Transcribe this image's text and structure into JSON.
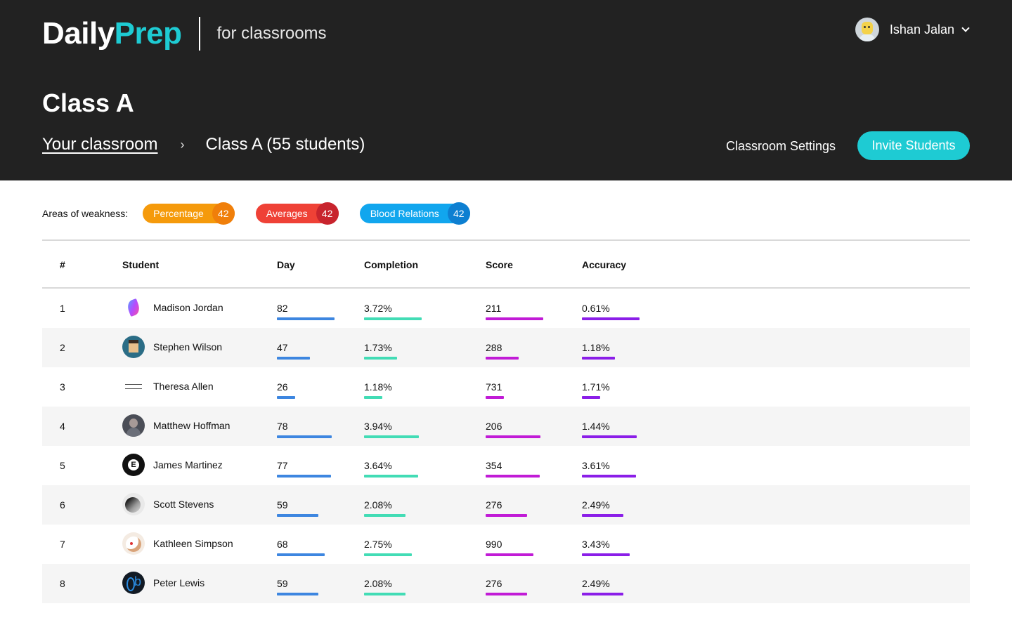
{
  "brand": {
    "part1": "Daily",
    "part2": "Prep",
    "subtitle": "for classrooms"
  },
  "user": {
    "name": "Ishan Jalan",
    "avatar_icon": "user-avatar"
  },
  "page": {
    "title": "Class A"
  },
  "breadcrumb": {
    "link": "Your classroom",
    "separator": "›",
    "current": "Class A (55 students)"
  },
  "actions": {
    "settings": "Classroom Settings",
    "invite": "Invite Students"
  },
  "weakness": {
    "label": "Areas of weakness:",
    "chips": [
      {
        "label": "Percentage",
        "count": "42",
        "color": "#f59a0b"
      },
      {
        "label": "Averages",
        "count": "42",
        "color": "#ef4136"
      },
      {
        "label": "Blood Relations",
        "count": "42",
        "color": "#11a6ee"
      }
    ]
  },
  "table": {
    "headers": {
      "num": "#",
      "student": "Student",
      "day": "Day",
      "completion": "Completion",
      "score": "Score",
      "accuracy": "Accuracy"
    },
    "bar_colors": {
      "day": "#3d86e0",
      "completion": "#42dcb5",
      "score": "#c11bd6",
      "accuracy": "#8b1ee8"
    },
    "rows": [
      {
        "num": "1",
        "name": "Madison Jordan",
        "day": "82",
        "completion": "3.72%",
        "score": "211",
        "accuracy": "0.61%"
      },
      {
        "num": "2",
        "name": "Stephen Wilson",
        "day": "47",
        "completion": "1.73%",
        "score": "288",
        "accuracy": "1.18%"
      },
      {
        "num": "3",
        "name": "Theresa Allen",
        "day": "26",
        "completion": "1.18%",
        "score": "731",
        "accuracy": "1.71%"
      },
      {
        "num": "4",
        "name": "Matthew Hoffman",
        "day": "78",
        "completion": "3.94%",
        "score": "206",
        "accuracy": "1.44%"
      },
      {
        "num": "5",
        "name": "James Martinez",
        "day": "77",
        "completion": "3.64%",
        "score": "354",
        "accuracy": "3.61%"
      },
      {
        "num": "6",
        "name": "Scott Stevens",
        "day": "59",
        "completion": "2.08%",
        "score": "276",
        "accuracy": "2.49%"
      },
      {
        "num": "7",
        "name": "Kathleen Simpson",
        "day": "68",
        "completion": "2.75%",
        "score": "990",
        "accuracy": "3.43%"
      },
      {
        "num": "8",
        "name": "Peter Lewis",
        "day": "59",
        "completion": "2.08%",
        "score": "276",
        "accuracy": "2.49%"
      }
    ]
  }
}
